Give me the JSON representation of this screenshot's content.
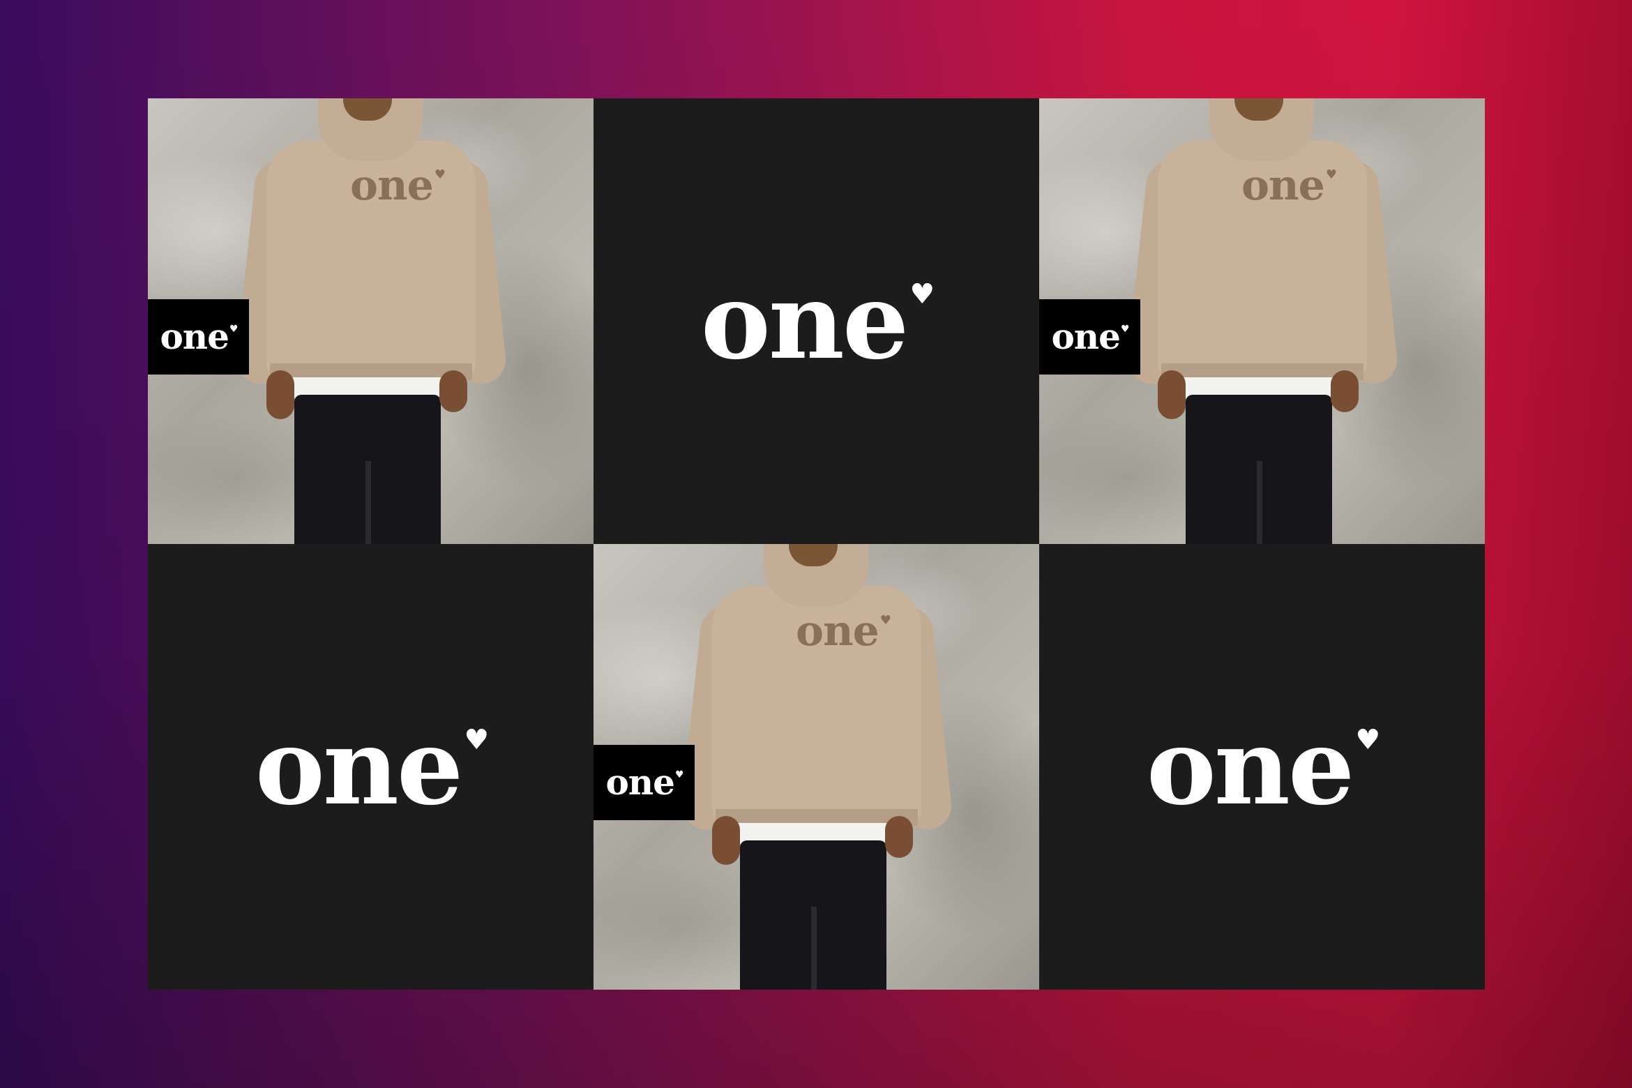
{
  "brand": {
    "wordmark": "one",
    "heart_icon": "heart-icon"
  },
  "tiles": [
    {
      "kind": "photo",
      "chest_text": "one",
      "badge_text": "one"
    },
    {
      "kind": "logo",
      "text": "one"
    },
    {
      "kind": "photo",
      "chest_text": "one",
      "badge_text": "one"
    },
    {
      "kind": "logo",
      "text": "one"
    },
    {
      "kind": "photo",
      "chest_text": "one",
      "badge_text": "one"
    },
    {
      "kind": "logo",
      "text": "one"
    }
  ],
  "colors": {
    "gradient_left": "#3a0c5e",
    "gradient_right": "#d01440",
    "tile_dark": "#1c1c1c",
    "hoodie": "#c9b29a"
  }
}
